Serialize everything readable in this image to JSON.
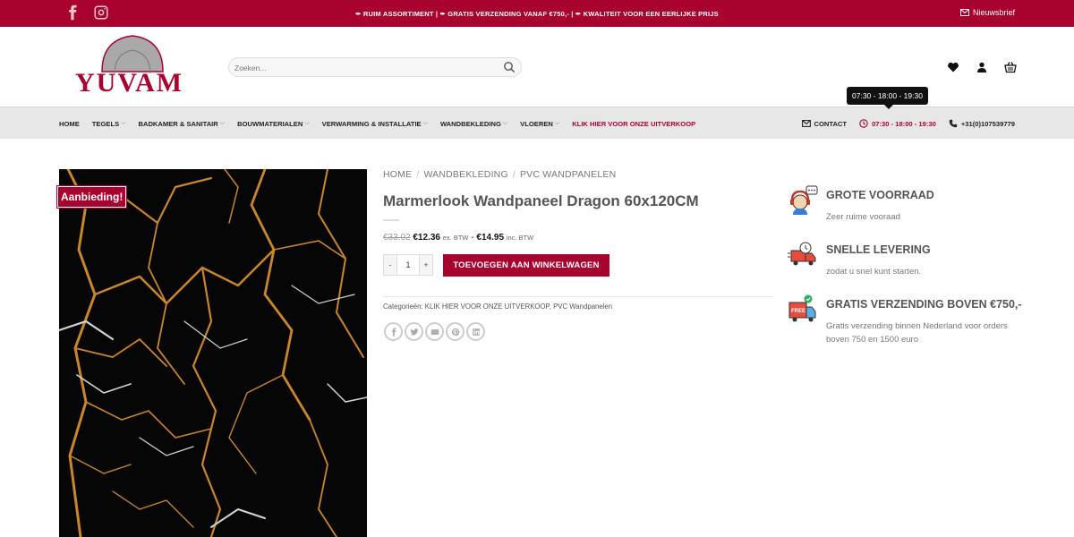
{
  "topbar": {
    "promo": "✒ RUIM ASSORTIMENT | ✒ GRATIS VERZENDING VANAF €750,- | ✒ KWALITEIT VOOR EEN EERLIJKE PRIJS",
    "newsletter": "Nieuwsbrief"
  },
  "header": {
    "logo_text": "YUVAM",
    "search_placeholder": "Zoeken..."
  },
  "nav": {
    "items": [
      {
        "label": "HOME",
        "chevron": false
      },
      {
        "label": "TEGELS",
        "chevron": true
      },
      {
        "label": "BADKAMER & SANITAIR",
        "chevron": true
      },
      {
        "label": "BOUWMATERIALEN",
        "chevron": true
      },
      {
        "label": "VERWARMING & INSTALLATIE",
        "chevron": true
      },
      {
        "label": "WANDBEKLEDING",
        "chevron": true
      },
      {
        "label": "VLOEREN",
        "chevron": true
      },
      {
        "label": "KLIK HIER VOOR ONZE UITVERKOOP",
        "chevron": false
      }
    ],
    "contact": "CONTACT",
    "hours": "07:30 - 18:00 - 19:30",
    "phone": "+31(0)107539779",
    "tooltip": "07:30 - 18:00 - 19:30"
  },
  "product": {
    "sale_badge": "Aanbieding!",
    "breadcrumb": [
      "HOME",
      "WANDBEKLEDING",
      "PVC WANDPANELEN"
    ],
    "title": "Marmerlook Wandpaneel Dragon 60x120CM",
    "old_price": "€33.02",
    "price_ex": "€12.36",
    "ex_label": "ex. BTW",
    "dash": "-",
    "price_inc": "€14.95",
    "inc_label": "inc. BTW",
    "qty_minus": "-",
    "qty_value": "1",
    "qty_plus": "+",
    "add_to_cart": "TOEVOEGEN AAN WINKELWAGEN",
    "categories": "Categorieën: KLIK HIER VOOR ONZE UITVERKOOP, PVC Wandpanelen",
    "share_icons": [
      "facebook-icon",
      "twitter-icon",
      "email-icon",
      "pinterest-icon",
      "linkedin-icon"
    ]
  },
  "features": [
    {
      "icon": "support-agent-icon",
      "title": "GROTE VOORRAAD",
      "desc": "Zeer ruime vooraad"
    },
    {
      "icon": "fast-delivery-icon",
      "title": "SNELLE LEVERING",
      "desc": "zodat u snel kunt starten."
    },
    {
      "icon": "free-shipping-truck-icon",
      "title": "GRATIS VERZENDING BOVEN €750,-",
      "desc": "Gratis verzending binnen Nederland voor orders boven 750 en 1500 euro"
    }
  ],
  "colors": {
    "brand": "#a8032f",
    "nav_bg": "#e7e7e7",
    "marble_gold": "#c9862a",
    "marble_white": "#cfd6d8"
  }
}
